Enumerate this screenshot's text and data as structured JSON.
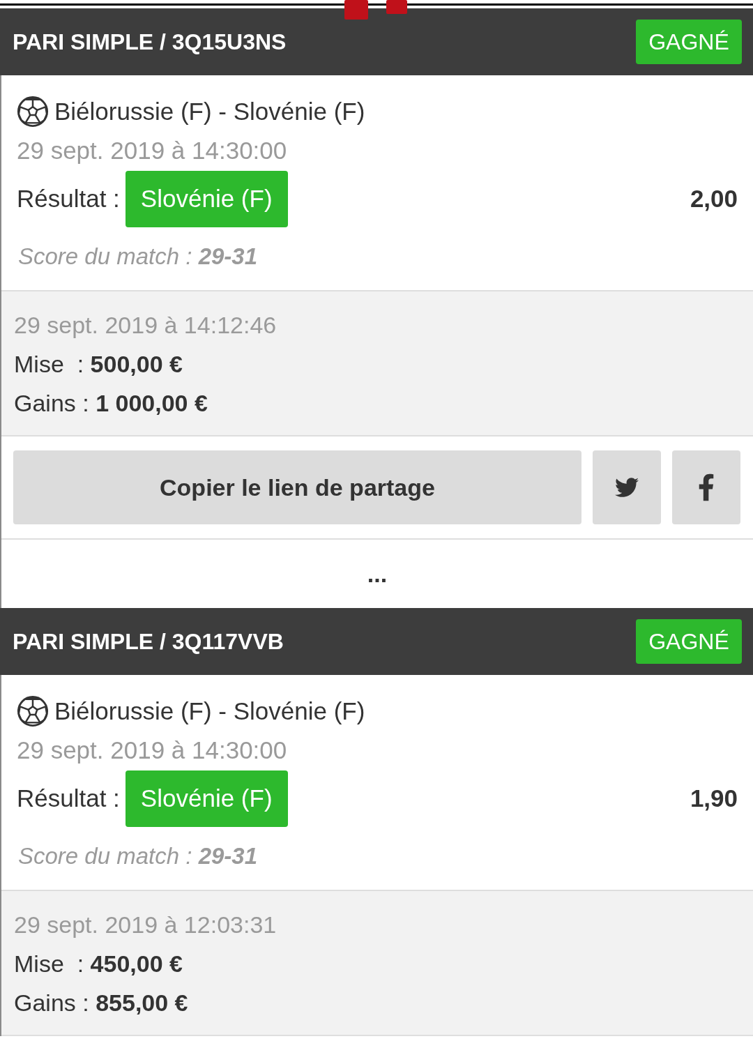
{
  "bets": [
    {
      "title": "PARI SIMPLE / 3Q15U3NS",
      "status": {
        "label": "GAGNÉ",
        "kind": "won"
      },
      "event": "Biélorussie (F) - Slovénie (F)",
      "event_date": "29 sept. 2019 à 14:30:00",
      "result_label": "Résultat :",
      "result": "Slovénie (F)",
      "odds": "2,00",
      "score_label": "Score du match :",
      "score": "29-31",
      "placed_at": "29 sept. 2019 à 14:12:46",
      "stake_label": "Mise  :",
      "stake": "500,00 €",
      "winnings_label": "Gains :",
      "winnings": "1 000,00 €",
      "share": {
        "copy_label": "Copier le lien de partage"
      },
      "more": "..."
    },
    {
      "title": "PARI SIMPLE / 3Q117VVB",
      "status": {
        "label": "GAGNÉ",
        "kind": "won"
      },
      "event": "Biélorussie (F) - Slovénie (F)",
      "event_date": "29 sept. 2019 à 14:30:00",
      "result_label": "Résultat :",
      "result": "Slovénie (F)",
      "odds": "1,90",
      "score_label": "Score du match :",
      "score": "29-31",
      "placed_at": "29 sept. 2019 à 12:03:31",
      "stake_label": "Mise  :",
      "stake": "450,00 €",
      "winnings_label": "Gains :",
      "winnings": "855,00 €"
    }
  ]
}
